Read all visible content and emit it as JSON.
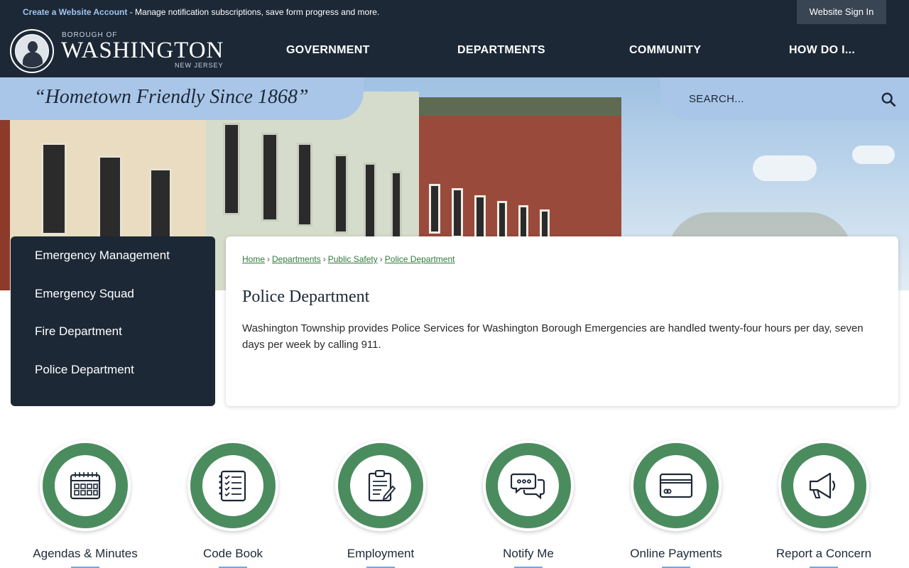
{
  "topbar": {
    "create_account_link": "Create a Website Account",
    "message": " - Manage notification subscriptions, save form progress and more.",
    "sign_in": "Website Sign In"
  },
  "brand": {
    "top": "BOROUGH OF",
    "name": "WASHINGTON",
    "sub": "NEW JERSEY"
  },
  "nav": {
    "items": [
      {
        "label": "GOVERNMENT"
      },
      {
        "label": "DEPARTMENTS"
      },
      {
        "label": "COMMUNITY"
      },
      {
        "label": "HOW DO I..."
      }
    ]
  },
  "tagline": "“Hometown Friendly Since 1868”",
  "search": {
    "placeholder": "SEARCH...",
    "icon": "search-icon"
  },
  "sidenav": {
    "items": [
      {
        "label": "Emergency Management"
      },
      {
        "label": "Emergency Squad"
      },
      {
        "label": "Fire Department"
      },
      {
        "label": "Police Department"
      }
    ]
  },
  "breadcrumb": {
    "items": [
      "Home",
      "Departments",
      "Public Safety",
      "Police Department"
    ],
    "separator": "›"
  },
  "page": {
    "title": "Police Department",
    "body": "Washington Township provides Police Services for Washington Borough Emergencies are handled twenty-four hours per day, seven days per week by calling 911."
  },
  "quick_links": [
    {
      "label": "Agendas & Minutes",
      "icon": "calendar-icon"
    },
    {
      "label": "Code Book",
      "icon": "checklist-icon"
    },
    {
      "label": "Employment",
      "icon": "clipboard-icon"
    },
    {
      "label": "Notify Me",
      "icon": "chat-bubbles-icon"
    },
    {
      "label": "Online Payments",
      "icon": "credit-card-icon"
    },
    {
      "label": "Report a Concern",
      "icon": "megaphone-icon"
    }
  ],
  "colors": {
    "navy": "#1d2836",
    "light_blue": "#a9c6e8",
    "green": "#4a8c5e",
    "link_green": "#2f7a3a"
  }
}
